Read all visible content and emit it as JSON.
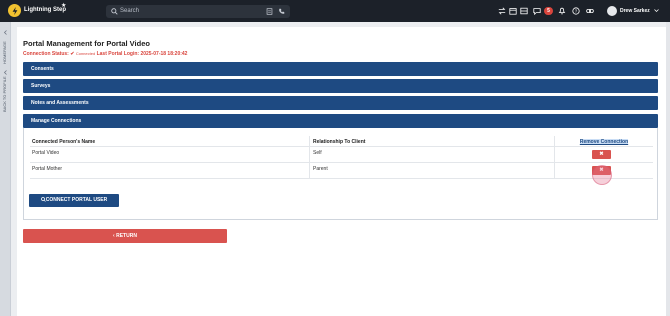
{
  "app": {
    "brand": "Lightning Step",
    "fav_icon": "star-icon",
    "logo_icon": "lightning-logo-icon"
  },
  "search": {
    "placeholder": "Search"
  },
  "header": {
    "notification_count": "5",
    "user_name": "Drew Sarkez",
    "icons": [
      "transfer-icon",
      "calendar-icon",
      "inbox-icon",
      "chat-icon",
      "bell-icon",
      "help-icon",
      "link-icon"
    ]
  },
  "rail": {
    "item1": "HOMEPAGE",
    "item2": "BACK TO PROFILE"
  },
  "page": {
    "title": "Portal Management for Portal Video",
    "status_label": "Connection Status:",
    "status_icon": "✔",
    "status_value": "Connected",
    "last_login_label": "Last Portal Login:",
    "last_login_value": "2025-07-18 18:20:42"
  },
  "sections": {
    "consents": "Consents",
    "surveys": "Surveys",
    "notes": "Notes and Assessments",
    "manage": "Manage Connections"
  },
  "table": {
    "headers": {
      "name": "Connected Person's Name",
      "relationship": "Relationship To Client",
      "remove": "Remove Connection"
    },
    "rows": [
      {
        "name": "Portal Video",
        "relationship": "Self",
        "remove": "✖"
      },
      {
        "name": "Portal Mother",
        "relationship": "Parent",
        "remove": "✖"
      }
    ]
  },
  "buttons": {
    "connect": "CONNECT PORTAL USER",
    "return": "RETURN"
  },
  "colors": {
    "topbar": "#1c2129",
    "accent": "#1e4a82",
    "danger": "#d9534f",
    "logo": "#f2c230"
  }
}
